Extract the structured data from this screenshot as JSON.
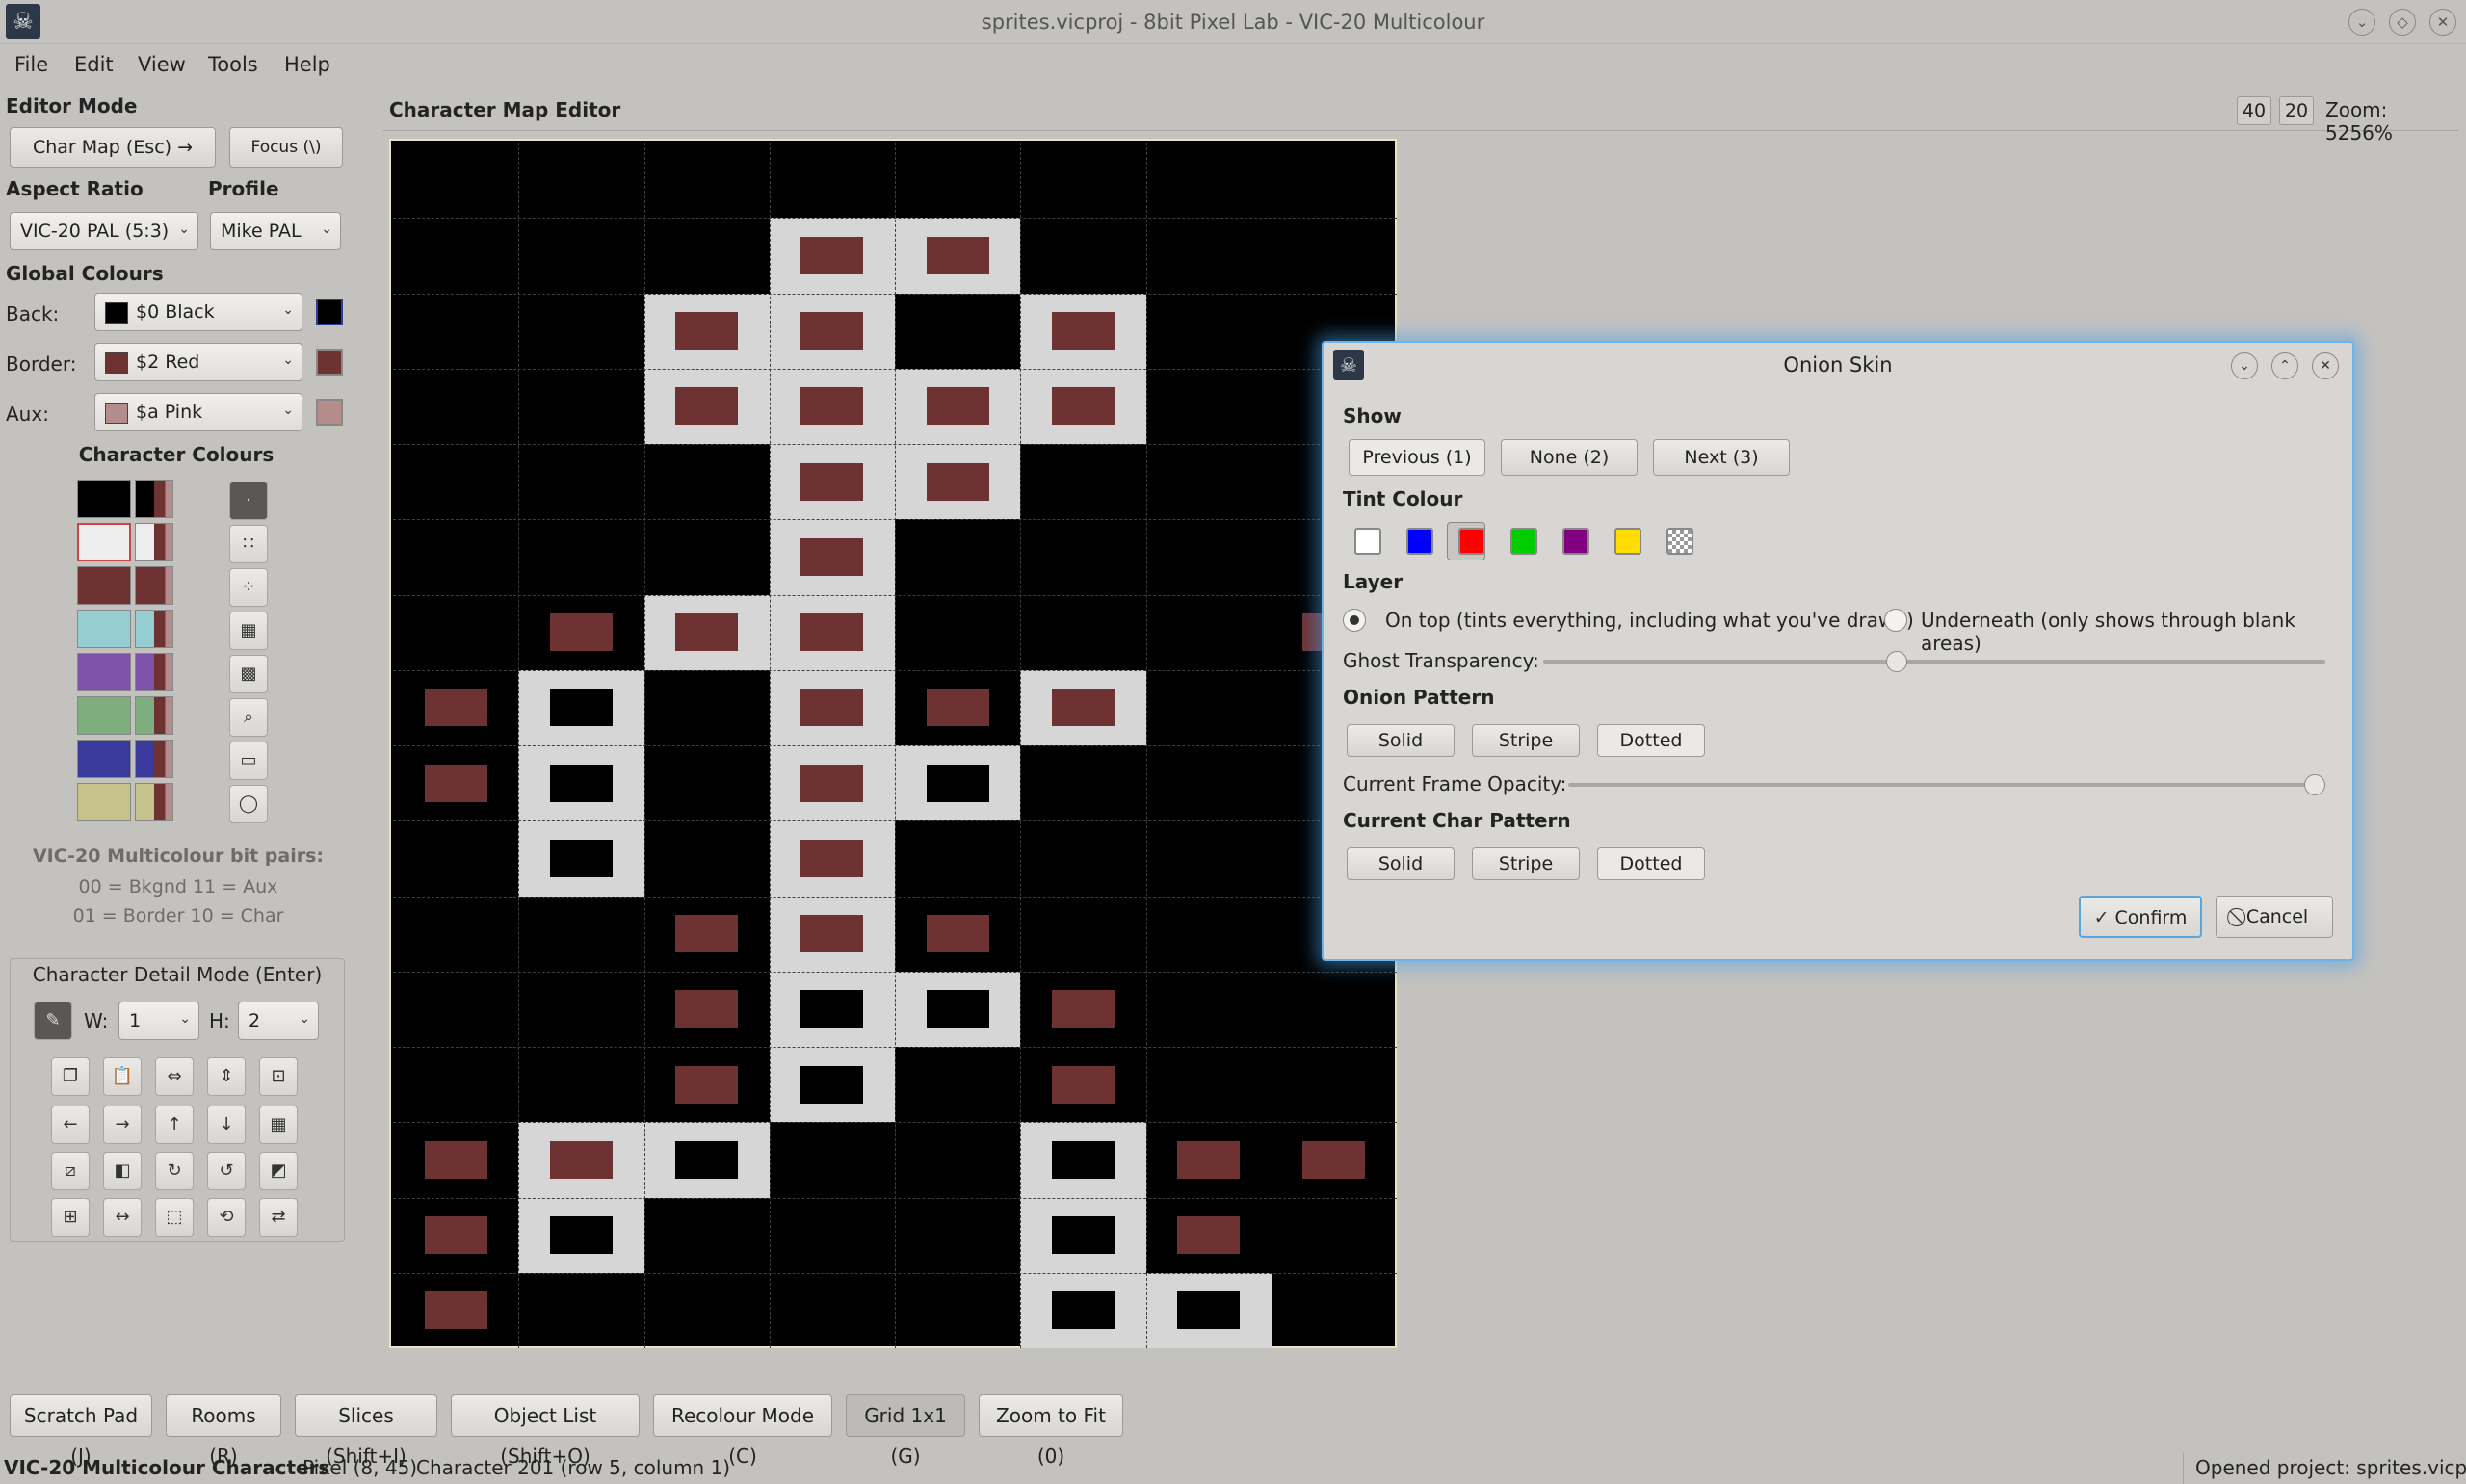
{
  "window": {
    "title": "sprites.vicproj - 8bit Pixel Lab - VIC-20 Multicolour"
  },
  "menu": [
    "File",
    "Edit",
    "View",
    "Tools",
    "Help"
  ],
  "sidebar": {
    "editor_mode_label": "Editor Mode",
    "char_map_button": "Char Map (Esc) →",
    "focus_button": "Focus (\\)",
    "aspect_ratio_label": "Aspect Ratio",
    "aspect_ratio_value": "VIC-20 PAL (5:3)",
    "profile_label": "Profile",
    "profile_value": "Mike PAL",
    "global_colours_label": "Global Colours",
    "back": {
      "label": "Back:",
      "value": "$0 Black",
      "color": "#000000"
    },
    "border": {
      "label": "Border:",
      "value": "$2 Red",
      "color": "#6e3232"
    },
    "aux": {
      "label": "Aux:",
      "value": "$a Pink",
      "color": "#b48c8c"
    },
    "character_colours_label": "Character Colours",
    "palette": [
      "#000000",
      "#ededed",
      "#6e3232",
      "#96cdd0",
      "#7e52a8",
      "#7eae7e",
      "#3a3a9c",
      "#c6c28c"
    ],
    "bit_pairs_title": "VIC-20 Multicolour bit pairs:",
    "bit_pairs_line1": "00 = Bkgnd  11 = Aux",
    "bit_pairs_line2": "01 = Border 10 = Char",
    "detail_mode_label": "Character Detail Mode (Enter)",
    "w_label": "W:",
    "w_value": "1",
    "h_label": "H:",
    "h_value": "2"
  },
  "editor": {
    "title": "Character Map Editor",
    "cols": "40",
    "rows": "20",
    "zoom": "Zoom: 5256%"
  },
  "pixel_map": {
    "rows": [
      "KKKKKKKK",
      "KKKRRKKK",
      "KKRRKRKK",
      "KKRRRRKK",
      "KKKRRKKK",
      "KKKRKKKK",
      "KrRRKKKr",
      "rBKRrRKK",
      "rBKRBKKK",
      "KBKRKKKK",
      "KKrRrKKK",
      "KKrBBrKK",
      "KKrBKrKK",
      "rRBKKBrr",
      "rBKKKBrK",
      "rKKKKBBK"
    ],
    "legend": {
      "K": "background",
      "R": "border pixel on char",
      "r": "border pixel",
      "B": "background on char"
    }
  },
  "bottom_buttons": [
    "Scratch Pad (J)",
    "Rooms (R)",
    "Slices (Shift+I)",
    "Object List (Shift+O)",
    "Recolour Mode (C)",
    "Grid 1x1 (G)",
    "Zoom to Fit (0)"
  ],
  "status": {
    "mode": "VIC-20 Multicolour Characters",
    "pixel": "Pixel (8, 45)",
    "character": "Character 201 (row 5, column 1)",
    "project": "Opened project: sprites.vicproj"
  },
  "dialog": {
    "title": "Onion Skin",
    "show_label": "Show",
    "show_buttons": [
      "Previous (1)",
      "None (2)",
      "Next (3)"
    ],
    "tint_label": "Tint Colour",
    "tints": [
      "#ffffff",
      "#0000ff",
      "#ff0000",
      "#00cc00",
      "#800080",
      "#ffdd00",
      "checker"
    ],
    "layer_label": "Layer",
    "layer_on_top": "On top (tints everything, including what you've drawn)",
    "layer_underneath": "Underneath (only shows through blank areas)",
    "ghost_label": "Ghost Transparency:",
    "ghost_value": 0.45,
    "onion_pattern_label": "Onion Pattern",
    "patterns": [
      "Solid",
      "Stripe",
      "Dotted"
    ],
    "frame_opacity_label": "Current Frame Opacity:",
    "frame_opacity_value": 1.0,
    "char_pattern_label": "Current Char Pattern",
    "confirm": "Confirm",
    "cancel": "Cancel"
  }
}
